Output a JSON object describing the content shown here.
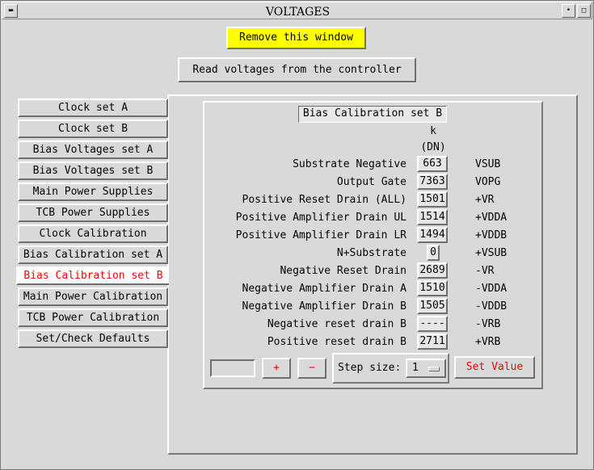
{
  "window": {
    "title": "VOLTAGES",
    "titlebar_buttons": [
      "menu-icon",
      "minimize-icon",
      "maximize-icon"
    ]
  },
  "top_buttons": {
    "remove": "Remove this window",
    "read": "Read voltages from the controller"
  },
  "colors": {
    "highlight_yellow": "#ffff00",
    "active_red": "#ff0000",
    "background": "#d9d9d9"
  },
  "sidebar": {
    "active_index": 8,
    "items": [
      {
        "label": "Clock set A"
      },
      {
        "label": "Clock set B"
      },
      {
        "label": "Bias Voltages set A"
      },
      {
        "label": "Bias Voltages set B"
      },
      {
        "label": "Main Power Supplies"
      },
      {
        "label": "TCB Power Supplies"
      },
      {
        "label": "Clock Calibration"
      },
      {
        "label": "Bias Calibration set A"
      },
      {
        "label": "Bias Calibration set B"
      },
      {
        "label": "Main Power Calibration"
      },
      {
        "label": "TCB Power Calibration"
      },
      {
        "label": "Set/Check Defaults"
      }
    ]
  },
  "panel": {
    "title": "Bias Calibration set B",
    "header_k": "k",
    "header_unit": "(DN)",
    "rows": [
      {
        "label": "Substrate Negative",
        "value": "663",
        "code": "VSUB"
      },
      {
        "label": "Output Gate",
        "value": "7363",
        "code": "VOPG"
      },
      {
        "label": "Positive Reset Drain (ALL)",
        "value": "1501",
        "code": "+VR"
      },
      {
        "label": "Positive Amplifier Drain UL",
        "value": "1514",
        "code": "+VDDA"
      },
      {
        "label": "Positive Amplifier Drain LR",
        "value": "1494",
        "code": "+VDDB"
      },
      {
        "label": "N+Substrate",
        "value": "0",
        "code": "+VSUB"
      },
      {
        "label": "Negative Reset Drain",
        "value": "2689",
        "code": "-VR"
      },
      {
        "label": "Negative Amplifier Drain A",
        "value": "1510",
        "code": "-VDDA"
      },
      {
        "label": "Negative Amplifier Drain B",
        "value": "1505",
        "code": "-VDDB"
      },
      {
        "label": "Negative reset drain B",
        "value": "----",
        "code": "-VRB"
      },
      {
        "label": "Positive reset drain B",
        "value": "2711",
        "code": "+VRB"
      }
    ]
  },
  "controls": {
    "entry_value": "",
    "plus": "+",
    "minus": "−",
    "step_label": "Step size:",
    "step_value": "1",
    "set_value": "Set Value"
  }
}
